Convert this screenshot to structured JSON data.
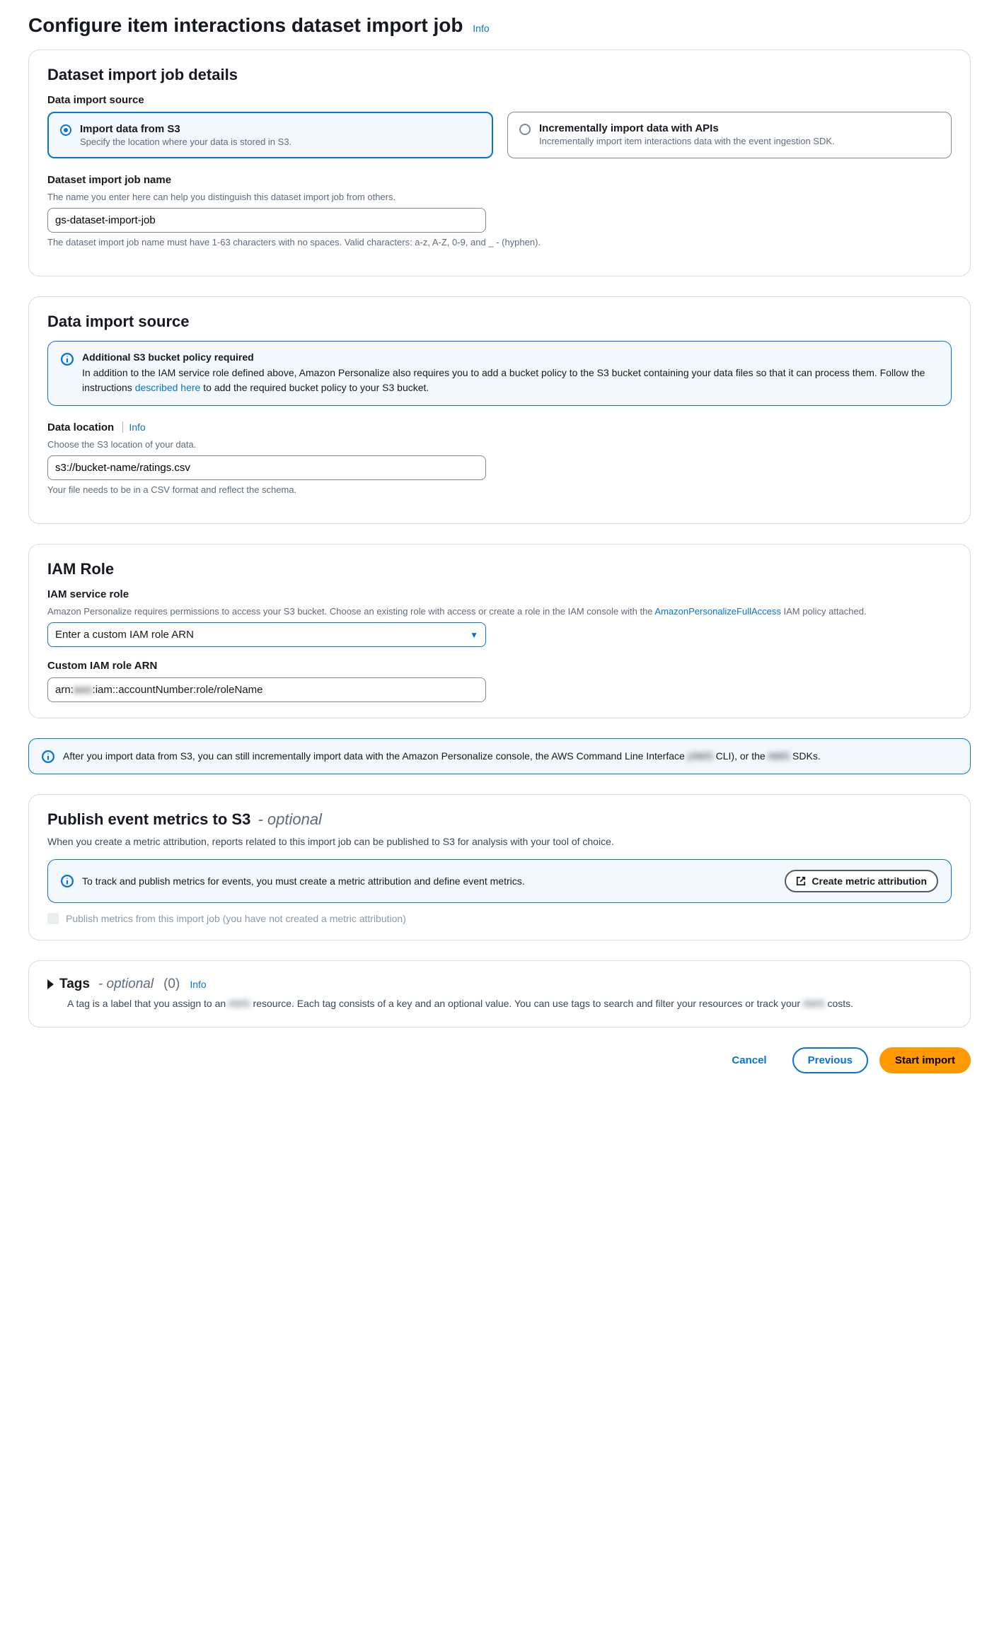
{
  "page": {
    "title": "Configure item interactions dataset import job",
    "info": "Info"
  },
  "details": {
    "panel_title": "Dataset import job details",
    "source_label": "Data import source",
    "option_s3": {
      "title": "Import data from S3",
      "desc": "Specify the location where your data is stored in S3."
    },
    "option_api": {
      "title": "Incrementally import data with APIs",
      "desc": "Incrementally import item interactions data with the event ingestion SDK."
    },
    "job_name_label": "Dataset import job name",
    "job_name_hint": "The name you enter here can help you distinguish this dataset import job from others.",
    "job_name_value": "gs-dataset-import-job",
    "job_name_constraint": "The dataset import job name must have 1-63 characters with no spaces. Valid characters: a-z, A-Z, 0-9, and _ - (hyphen)."
  },
  "source": {
    "panel_title": "Data import source",
    "alert_title": "Additional S3 bucket policy required",
    "alert_body_a": "In addition to the IAM service role defined above, Amazon Personalize also requires you to add a bucket policy to the S3 bucket containing your data files so that it can process them. Follow the instructions ",
    "alert_link": "described here",
    "alert_body_b": " to add the required bucket policy to your S3 bucket.",
    "location_label": "Data location",
    "location_info": "Info",
    "location_hint": "Choose the S3 location of your data.",
    "location_value": "s3://bucket-name/ratings.csv",
    "location_constraint": "Your file needs to be in a CSV format and reflect the schema."
  },
  "iam": {
    "panel_title": "IAM Role",
    "role_label": "IAM service role",
    "role_hint_a": "Amazon Personalize requires permissions to access your S3 bucket. Choose an existing role with access or create a role in the IAM console with the ",
    "role_hint_link": "AmazonPersonalizeFullAccess",
    "role_hint_b": " IAM policy attached.",
    "select_value": "Enter a custom IAM role ARN",
    "arn_label": "Custom IAM role ARN",
    "arn_prefix": "arn:",
    "arn_blur": "aws",
    "arn_suffix": ":iam::accountNumber:role/roleName"
  },
  "incremental_alert": {
    "a": "After you import data from S3, you can still incrementally import data with the Amazon Personalize console, the AWS Command Line Interface ",
    "b_blur": "(AWS",
    "c": " CLI), or the ",
    "d_blur": "AWS",
    "e": " SDKs."
  },
  "metrics": {
    "title": "Publish event metrics to S3",
    "optional": "- optional",
    "desc": "When you create a metric attribution, reports related to this import job can be published to S3 for analysis with your tool of choice.",
    "alert_text": "To track and publish metrics for events, you must create a metric attribution and define event metrics.",
    "create_btn": "Create metric attribution",
    "checkbox_label": "Publish metrics from this import job (you have not created a metric attribution)"
  },
  "tags": {
    "title": "Tags",
    "optional": "- optional",
    "count": "(0)",
    "info": "Info",
    "desc_a": "A tag is a label that you assign to an ",
    "desc_blur_1": "AWS",
    "desc_b": " resource. Each tag consists of a key and an optional value. You can use tags to search and filter your resources or track your ",
    "desc_blur_2": "AWS",
    "desc_c": " costs."
  },
  "footer": {
    "cancel": "Cancel",
    "previous": "Previous",
    "start": "Start import"
  }
}
